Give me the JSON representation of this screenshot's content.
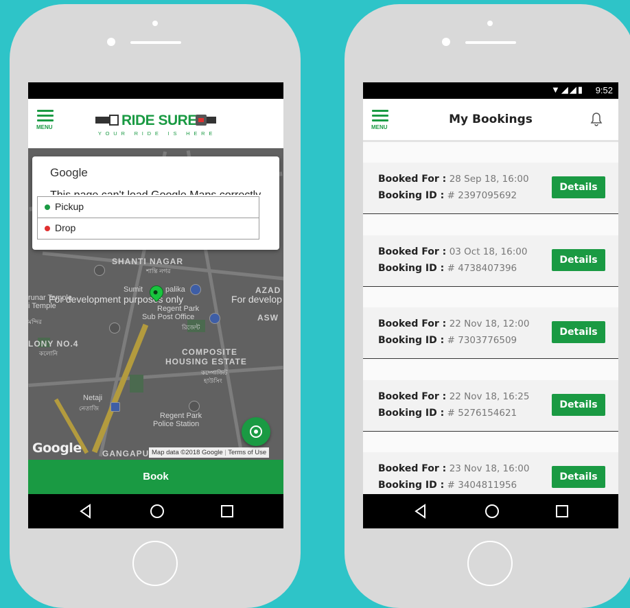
{
  "left_phone": {
    "app": {
      "menu_label": "MENU",
      "brand": "RIDE SURE",
      "tagline": "YOUR RIDE IS HERE"
    },
    "dialog": {
      "title": "Google",
      "message": "This page can't load Google Maps correctly."
    },
    "fields": [
      {
        "label": "Pickup",
        "dot_color": "#1a9a43"
      },
      {
        "label": "Drop",
        "dot_color": "#e03030"
      }
    ],
    "map": {
      "labels": {
        "shanti_nagar": "SHANTI NAGAR",
        "shanti_bn": "শান্তি নগর",
        "sumit": "Sumit",
        "palika": "palika",
        "azad": "AZAD",
        "asw": "ASW",
        "temple": "runar Temple",
        "temple2": "i Temple",
        "temple_bn": "মন্দির",
        "regent_po": "Regent Park",
        "sub_po": "Sub Post Office",
        "regent_bn": "রিজেন্ট",
        "colony": "LONY NO.4",
        "colony_bn": "কলোনি",
        "composite": "COMPOSITE",
        "housing": "HOUSING ESTATE",
        "housing_bn1": "কম্পোজিট",
        "housing_bn2": "হাউসিং",
        "netaji": "Netaji",
        "netaji_bn": "নেতাজি",
        "regent_ps": "Regent Park",
        "police": "Police Station",
        "gangapu": "GANGAPU"
      },
      "dev_notice_1": "For development purposes only",
      "dev_notice_2": "For develop",
      "google_logo": "Google",
      "map_data": "Map data ©2018 Google",
      "terms": "Terms of Use"
    },
    "book_button": "Book",
    "accent_color": "#1a9a43"
  },
  "right_phone": {
    "status": {
      "time": "9:52"
    },
    "app": {
      "menu_label": "MENU",
      "title": "My Bookings"
    },
    "bookings": [
      {
        "booked_for_label": "Booked For :",
        "booked_for": "28 Sep 18, 16:00",
        "id_label": "Booking ID :",
        "booking_id": "# 2397095692",
        "button": "Details"
      },
      {
        "booked_for_label": "Booked For :",
        "booked_for": "03 Oct 18, 16:00",
        "id_label": "Booking ID :",
        "booking_id": "# 4738407396",
        "button": "Details"
      },
      {
        "booked_for_label": "Booked For :",
        "booked_for": "22 Nov 18, 12:00",
        "id_label": "Booking ID :",
        "booking_id": "# 7303776509",
        "button": "Details"
      },
      {
        "booked_for_label": "Booked For :",
        "booked_for": "22 Nov 18, 16:25",
        "id_label": "Booking ID :",
        "booking_id": "# 5276154621",
        "button": "Details"
      },
      {
        "booked_for_label": "Booked For :",
        "booked_for": "23 Nov 18, 16:00",
        "id_label": "Booking ID :",
        "booking_id": "# 3404811956",
        "button": "Details"
      }
    ]
  }
}
